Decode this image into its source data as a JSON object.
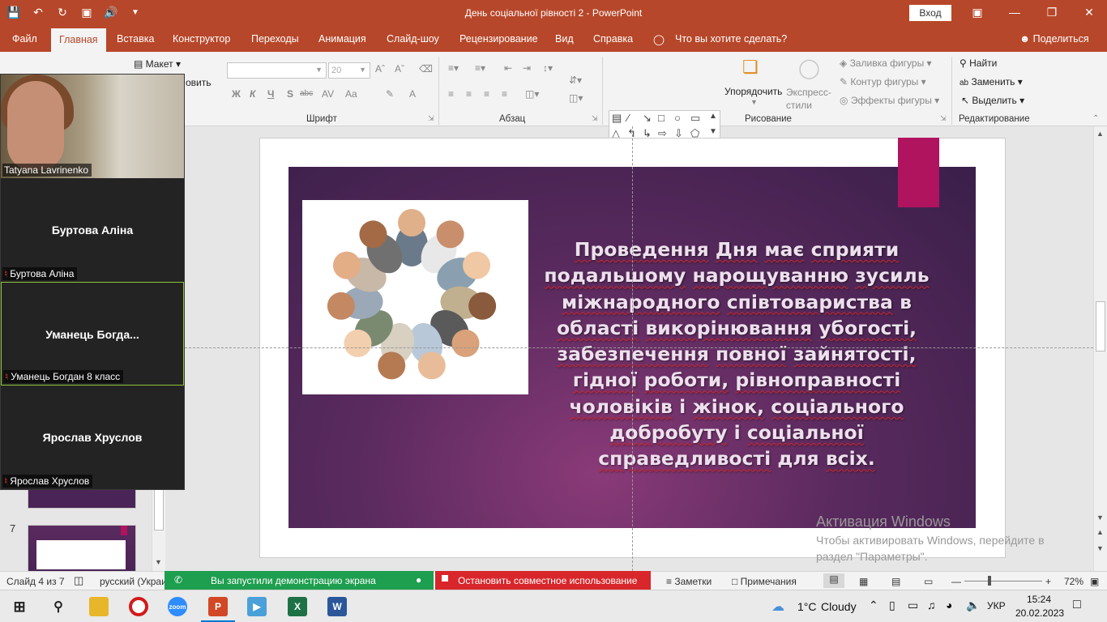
{
  "titlebar": {
    "title": "День соціальної рівності 2  -  PowerPoint",
    "signin": "Вход",
    "accent": "#b7472a"
  },
  "menu": {
    "tabs": [
      "Файл",
      "Главная",
      "Вставка",
      "Конструктор",
      "Переходы",
      "Анимация",
      "Слайд-шоу",
      "Рецензирование",
      "Вид",
      "Справка"
    ],
    "tell_me": "Что вы хотите сделать?",
    "share": "Поделиться"
  },
  "ribbon": {
    "layout": "Макет",
    "font_group": "Шрифт",
    "font_size": "20",
    "paragraph_group": "Абзац",
    "drawing_group": "Рисование",
    "editing_group": "Редактирование",
    "arrange": "Упорядочить",
    "quick_styles": "Экспресс-стили",
    "shape_fill": "Заливка фигуры",
    "shape_outline": "Контур фигуры",
    "shape_effects": "Эффекты фигуры",
    "find": "Найти",
    "replace": "Заменить",
    "select": "Выделить",
    "format_bold": "Ж",
    "format_italic": "К",
    "format_underline": "Ч",
    "format_shadow": "S",
    "format_strike": "abc",
    "format_spacing": "AV",
    "format_case": "Aa",
    "format_color": "A",
    "clipboard_partial": "овить"
  },
  "zoom": {
    "participants": [
      {
        "display_name": "",
        "label": "Tatyana Lavrinenko",
        "video": true,
        "muted": false
      },
      {
        "display_name": "Буртова Аліна",
        "label": "Буртова Аліна",
        "video": false,
        "muted": true
      },
      {
        "display_name": "Уманець  Богда...",
        "label": "Уманець Богдан 8 класс",
        "video": false,
        "muted": true,
        "active": true
      },
      {
        "display_name": "Ярослав Хруслов",
        "label": "Ярослав Хруслов",
        "video": false,
        "muted": true
      }
    ]
  },
  "slides_pane": {
    "visible_number": "7"
  },
  "slide": {
    "lines": [
      [
        "Проведення Дня має сприяти",
        true
      ],
      [
        "подальшому нарощуванню зусиль",
        true
      ],
      [
        "міжнародного співтовариства в",
        true
      ],
      [
        "області викорінювання убогості,",
        true
      ],
      [
        "забезпечення повної зайнятості,",
        true
      ],
      [
        "гідної роботи, рівноправності",
        true
      ],
      [
        "чоловіків і жінок, соціального",
        true
      ],
      [
        "добробуту і соціальної",
        true
      ],
      [
        "справедливості для всіх.",
        true
      ]
    ],
    "bg_color": "#4a2456",
    "accent_color": "#b0145f"
  },
  "activation": {
    "title": "Активация Windows",
    "line1": "Чтобы активировать Windows, перейдите в",
    "line2": "раздел \"Параметры\"."
  },
  "statusbar": {
    "slide_counter": "Слайд 4 из 7",
    "language": "русский (Украи",
    "sharing_msg": "Вы запустили демонстрацию экрана",
    "stop_sharing": "Остановить совместное использование",
    "notes": "Заметки",
    "comments": "Примечания",
    "zoom_level": "72%"
  },
  "taskbar": {
    "weather_temp": "1°C",
    "weather_text": "Cloudy",
    "lang": "УКР",
    "time": "15:24",
    "date": "20.02.2023",
    "zoom_app_label": "zoom"
  }
}
